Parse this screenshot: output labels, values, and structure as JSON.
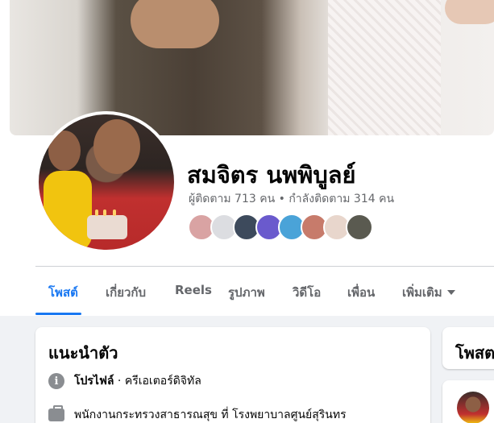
{
  "profile": {
    "name": "สมจิตร นพพิบูลย์",
    "followers_label": "ผู้ติดตาม",
    "followers_count": "713",
    "followers_unit": "คน",
    "separator": "•",
    "following_label": "กำลังติดตาม",
    "following_count": "314",
    "following_unit": "คน"
  },
  "friends": [
    {
      "name": "friend-1",
      "color": "#d9a3a3"
    },
    {
      "name": "friend-2",
      "color": "#dcdde1"
    },
    {
      "name": "friend-3",
      "color": "#3d4a5c"
    },
    {
      "name": "friend-4",
      "color": "#6a5acd"
    },
    {
      "name": "friend-5",
      "color": "#4aa3d8"
    },
    {
      "name": "friend-6",
      "color": "#c77b6b"
    },
    {
      "name": "friend-7",
      "color": "#e8d6cc"
    },
    {
      "name": "friend-8",
      "color": "#5a5a50"
    }
  ],
  "tabs": [
    {
      "label": "โพสต์",
      "active": true
    },
    {
      "label": "เกี่ยวกับ",
      "active": false
    },
    {
      "label": "Reels",
      "active": false
    },
    {
      "label": "รูปภาพ",
      "active": false
    },
    {
      "label": "วิดีโอ",
      "active": false
    },
    {
      "label": "เพื่อน",
      "active": false
    },
    {
      "label": "เพิ่มเติม",
      "active": false
    }
  ],
  "intro": {
    "title": "แนะนำตัว",
    "profile_label": "โปรไฟล์",
    "profile_dot": "·",
    "profile_category": "ครีเอเตอร์ดิจิทัล",
    "work_text": "พนักงานกระทรวงสาธารณสุข ที่ โรงพยาบาลศูนย์สุรินทร"
  },
  "posts": {
    "title": "โพสต"
  },
  "colors": {
    "accent": "#1877f2",
    "text_primary": "#050505",
    "text_secondary": "#65676b",
    "page_bg": "#f0f2f5"
  }
}
